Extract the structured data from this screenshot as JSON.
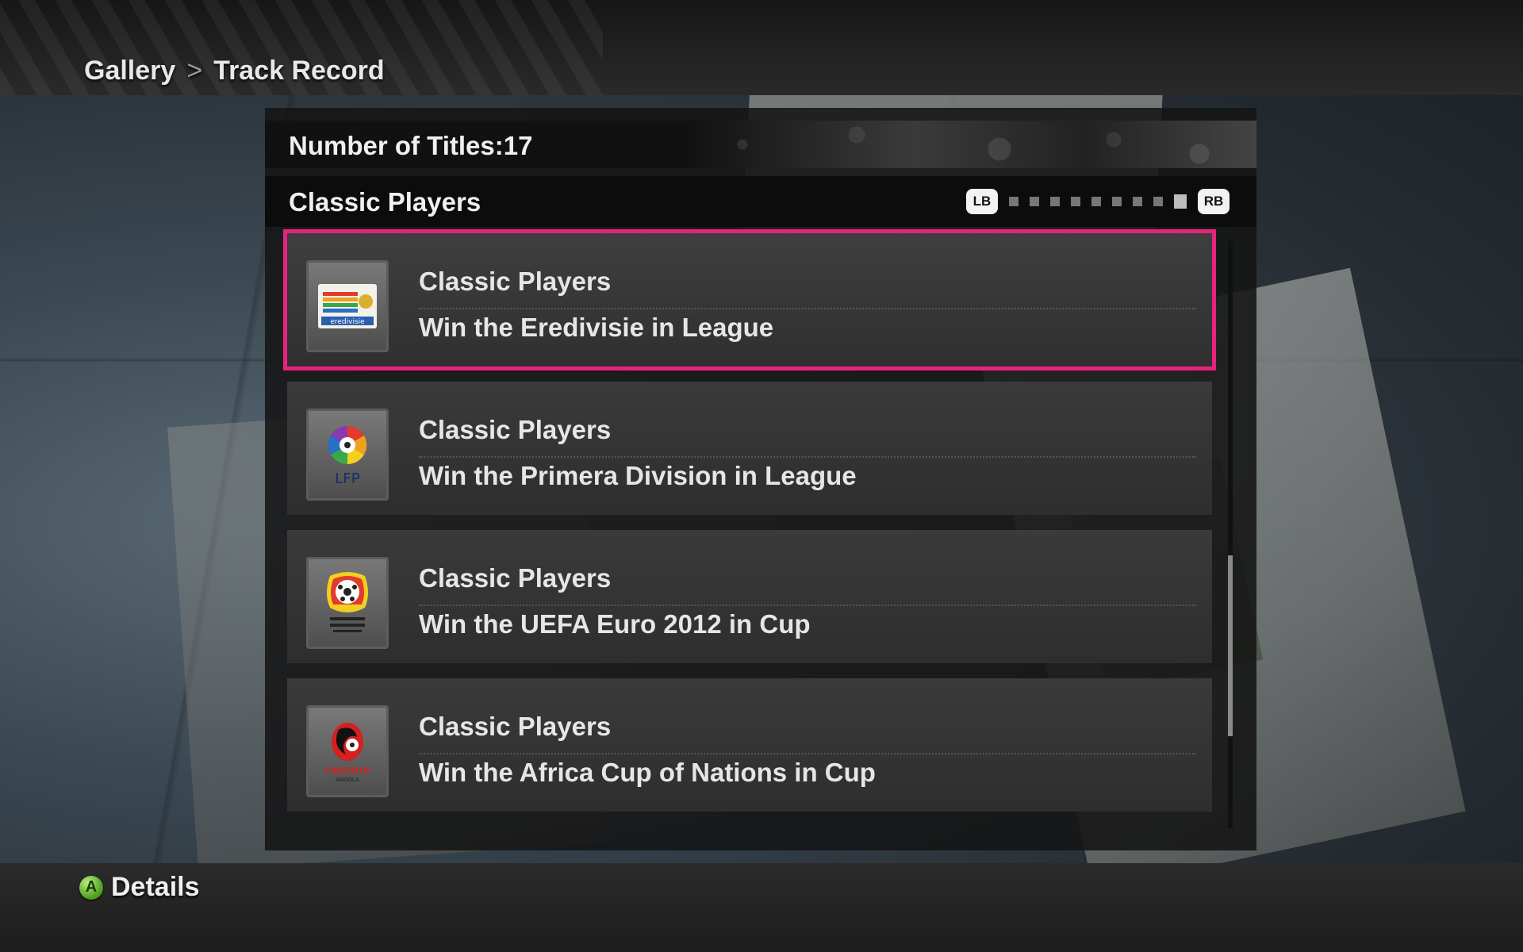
{
  "breadcrumb": {
    "root": "Gallery",
    "separator": ">",
    "current": "Track Record"
  },
  "panel": {
    "titles_count_label": "Number of Titles:17",
    "category": "Classic Players",
    "pager": {
      "left_button": "LB",
      "right_button": "RB",
      "pages": 9,
      "active_page": 9
    }
  },
  "items": [
    {
      "title": "Classic Players",
      "description": "Win the Eredivisie in League",
      "icon": "eredivisie-logo-icon",
      "selected": true
    },
    {
      "title": "Classic Players",
      "description": "Win the Primera Division in League",
      "icon": "lfp-logo-icon",
      "selected": false
    },
    {
      "title": "Classic Players",
      "description": "Win the UEFA Euro 2012 in Cup",
      "icon": "uefa-euro-2012-logo-icon",
      "selected": false
    },
    {
      "title": "Classic Players",
      "description": "Win the Africa Cup of Nations in Cup",
      "icon": "can-2010-logo-icon",
      "selected": false
    }
  ],
  "footer": {
    "button_glyph": "A",
    "action_label": "Details"
  },
  "colors": {
    "selection": "#e8237f",
    "a_button": "#4a9a20"
  }
}
